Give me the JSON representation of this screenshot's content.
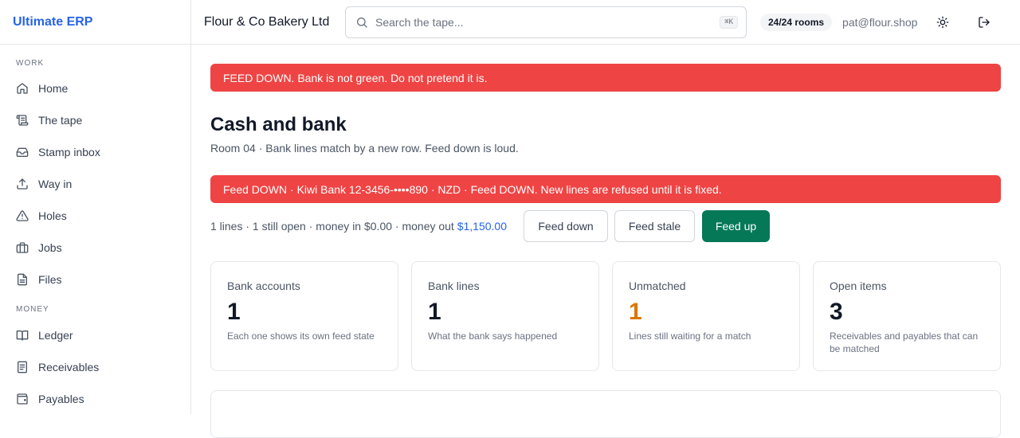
{
  "brand": "Ultimate ERP",
  "sidebar": {
    "sections": [
      {
        "title": "WORK",
        "items": [
          {
            "label": "Home",
            "icon": "home-icon"
          },
          {
            "label": "The tape",
            "icon": "scroll-icon"
          },
          {
            "label": "Stamp inbox",
            "icon": "inbox-icon"
          },
          {
            "label": "Way in",
            "icon": "upload-icon"
          },
          {
            "label": "Holes",
            "icon": "warning-icon"
          },
          {
            "label": "Jobs",
            "icon": "briefcase-icon"
          },
          {
            "label": "Files",
            "icon": "file-icon"
          }
        ]
      },
      {
        "title": "MONEY",
        "items": [
          {
            "label": "Ledger",
            "icon": "book-icon"
          },
          {
            "label": "Receivables",
            "icon": "receipt-icon"
          },
          {
            "label": "Payables",
            "icon": "wallet-icon"
          }
        ]
      }
    ]
  },
  "header": {
    "company": "Flour & Co Bakery Ltd",
    "search_placeholder": "Search the tape...",
    "shortcut": "⌘K",
    "rooms": "24/24 rooms",
    "email": "pat@flour.shop",
    "theme_icon": "sun-icon",
    "logout_icon": "logout-icon"
  },
  "main": {
    "alert_top": "FEED DOWN. Bank is not green. Do not pretend it is.",
    "title": "Cash and bank",
    "subtitle": "Room 04 · Bank lines match by a new row. Feed down is loud.",
    "alert_feed": "Feed DOWN · Kiwi Bank 12-3456-••••890 · NZD · Feed DOWN. New lines are refused until it is fixed.",
    "stats_text": "1 lines · 1 still open · money in $0.00 · money out",
    "money_out": "$1,150.00",
    "buttons": {
      "feed_down": "Feed down",
      "feed_stale": "Feed stale",
      "feed_up": "Feed up"
    },
    "cards": [
      {
        "label": "Bank accounts",
        "value": "1",
        "desc": "Each one shows its own feed state"
      },
      {
        "label": "Bank lines",
        "value": "1",
        "desc": "What the bank says happened"
      },
      {
        "label": "Unmatched",
        "value": "1",
        "desc": "Lines still waiting for a match"
      },
      {
        "label": "Open items",
        "value": "3",
        "desc": "Receivables and payables that can be matched"
      }
    ]
  },
  "colors": {
    "brand": "#2563eb",
    "alert": "#ef4444",
    "primary_button": "#047857",
    "warning_value": "#d97706",
    "link": "#2563eb"
  }
}
